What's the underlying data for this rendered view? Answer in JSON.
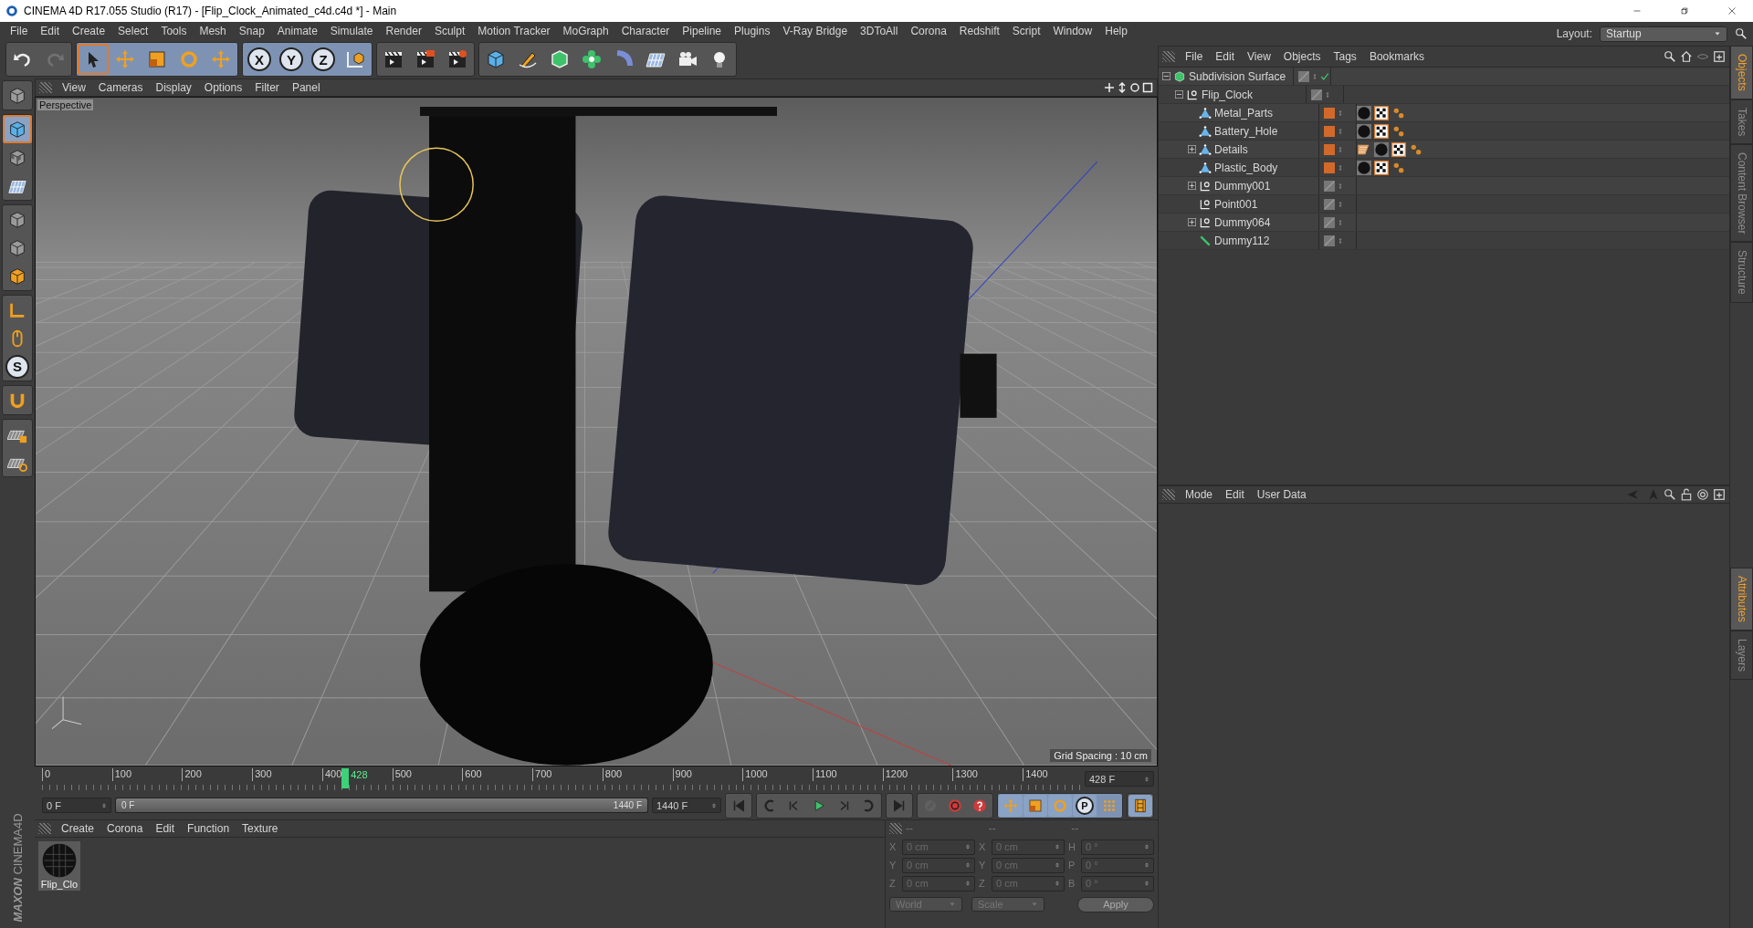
{
  "window": {
    "title": "CINEMA 4D R17.055 Studio (R17) - [Flip_Clock_Animated_c4d.c4d *] - Main"
  },
  "menu": [
    "File",
    "Edit",
    "Create",
    "Select",
    "Tools",
    "Mesh",
    "Snap",
    "Animate",
    "Simulate",
    "Render",
    "Sculpt",
    "Motion Tracker",
    "MoGraph",
    "Character",
    "Pipeline",
    "Plugins",
    "V-Ray Bridge",
    "3DToAll",
    "Corona",
    "Redshift",
    "Script",
    "Window",
    "Help"
  ],
  "layout": {
    "label": "Layout:",
    "value": "Startup"
  },
  "toolbar": [
    [
      {
        "kind": "undo-arrow",
        "selected": false,
        "disabled": false
      },
      {
        "kind": "redo-arrow",
        "selected": false,
        "disabled": true
      }
    ],
    [
      {
        "kind": "cursor",
        "selected": true,
        "disabled": false
      },
      {
        "kind": "move-arrows",
        "selected": false,
        "disabled": false
      },
      {
        "kind": "scale-square",
        "selected": false,
        "disabled": false
      },
      {
        "kind": "rotate-circle",
        "selected": false,
        "disabled": false
      },
      {
        "kind": "cross-arrows",
        "selected": false,
        "disabled": false
      }
    ],
    [
      {
        "kind": "letter",
        "label": "X",
        "selected": false,
        "disabled": false
      },
      {
        "kind": "letter",
        "label": "Y",
        "selected": false,
        "disabled": false
      },
      {
        "kind": "letter",
        "label": "Z",
        "selected": false,
        "disabled": false
      },
      {
        "kind": "coordinate-cube",
        "selected": false,
        "disabled": false
      }
    ],
    [
      {
        "kind": "clapper",
        "selected": false,
        "disabled": false
      },
      {
        "kind": "clapper-play",
        "selected": false,
        "disabled": false
      },
      {
        "kind": "clapper-gear",
        "selected": false,
        "disabled": false
      }
    ],
    [
      {
        "kind": "cube",
        "selected": false,
        "disabled": false
      },
      {
        "kind": "pen",
        "selected": false,
        "disabled": false
      },
      {
        "kind": "subdivision-cube",
        "selected": false,
        "disabled": false
      },
      {
        "kind": "flower",
        "selected": false,
        "disabled": false
      },
      {
        "kind": "bent-tube",
        "selected": false,
        "disabled": false
      },
      {
        "kind": "floor-grid",
        "selected": false,
        "disabled": false
      },
      {
        "kind": "camera",
        "selected": false,
        "disabled": false
      },
      {
        "kind": "light-bulb",
        "selected": false,
        "disabled": false
      }
    ]
  ],
  "side_tools": [
    [
      {
        "kind": "model-cube",
        "selected": false,
        "disabled": false
      }
    ],
    [
      {
        "kind": "cube",
        "selected": true,
        "disabled": false
      },
      {
        "kind": "checker-cube",
        "selected": false,
        "disabled": false
      },
      {
        "kind": "grid-plane",
        "selected": false,
        "disabled": false
      }
    ],
    [
      {
        "kind": "point-cube",
        "selected": false,
        "disabled": false
      },
      {
        "kind": "edge-cube",
        "selected": false,
        "disabled": false
      },
      {
        "kind": "polygon-cube",
        "selected": false,
        "disabled": false
      }
    ],
    [
      {
        "kind": "axis-corner",
        "selected": false,
        "disabled": false
      },
      {
        "kind": "mouse",
        "selected": false,
        "disabled": false
      },
      {
        "kind": "letter",
        "label": "S",
        "selected": false,
        "disabled": false
      }
    ],
    [
      {
        "kind": "magnet",
        "selected": false,
        "disabled": false
      }
    ],
    [
      {
        "kind": "grid-lock",
        "selected": false,
        "disabled": false
      },
      {
        "kind": "grid-snap",
        "selected": false,
        "disabled": false
      }
    ]
  ],
  "logo": {
    "brand": "MAXON",
    "product": "CINEMA4D"
  },
  "viewport": {
    "menu": [
      "View",
      "Cameras",
      "Display",
      "Options",
      "Filter",
      "Panel"
    ],
    "camera": "Perspective",
    "grid_spacing": "Grid Spacing : 10 cm"
  },
  "timeline": {
    "ticks": [
      "0",
      "100",
      "200",
      "300",
      "400",
      "500",
      "600",
      "700",
      "800",
      "900",
      "1000",
      "1100",
      "1200",
      "1300",
      "1400"
    ],
    "current": "428",
    "level": 0.297,
    "frame_field": "428 F"
  },
  "transport": {
    "start_field": "0 F",
    "range": {
      "start": "0 F",
      "end": "1440 F",
      "level": 1
    },
    "end_field": "1440 F",
    "buttons": [
      [
        {
          "kind": "go-start",
          "selected": false,
          "disabled": false
        }
      ],
      [
        {
          "kind": "loop-back",
          "selected": false,
          "disabled": false
        },
        {
          "kind": "step-back",
          "selected": false,
          "disabled": false
        },
        {
          "kind": "play",
          "selected": false,
          "disabled": false
        },
        {
          "kind": "step-forward",
          "selected": false,
          "disabled": false
        },
        {
          "kind": "loop-forward",
          "selected": false,
          "disabled": false
        }
      ],
      [
        {
          "kind": "go-end",
          "selected": false,
          "disabled": false
        }
      ],
      [
        {
          "kind": "key",
          "selected": false,
          "disabled": true
        },
        {
          "kind": "record",
          "selected": false,
          "disabled": false
        },
        {
          "kind": "question",
          "selected": false,
          "disabled": false
        }
      ],
      [
        {
          "kind": "move-arrows",
          "selected": true,
          "disabled": false
        },
        {
          "kind": "scale-square",
          "selected": true,
          "disabled": false
        },
        {
          "kind": "rotate-circle",
          "selected": true,
          "disabled": false
        },
        {
          "kind": "letter",
          "label": "P",
          "selected": true,
          "disabled": false
        },
        {
          "kind": "dots-grid",
          "selected": false,
          "disabled": false
        }
      ],
      [
        {
          "kind": "film-strip",
          "selected": true,
          "disabled": false
        }
      ]
    ]
  },
  "materials": {
    "menu": [
      "Create",
      "Corona",
      "Edit",
      "Function",
      "Texture"
    ],
    "items": [
      {
        "name": "Flip_Clo"
      }
    ]
  },
  "coordinates": {
    "disabled": true,
    "headers": [
      "--",
      "--",
      "--"
    ],
    "rows": [
      [
        {
          "axis": "X",
          "value": "0 cm"
        },
        {
          "axis": "X",
          "value": "0 cm"
        },
        {
          "axis": "H",
          "value": "0 °"
        }
      ],
      [
        {
          "axis": "Y",
          "value": "0 cm"
        },
        {
          "axis": "Y",
          "value": "0 cm"
        },
        {
          "axis": "P",
          "value": "0 °"
        }
      ],
      [
        {
          "axis": "Z",
          "value": "0 cm"
        },
        {
          "axis": "Z",
          "value": "0 cm"
        },
        {
          "axis": "B",
          "value": "0 °"
        }
      ]
    ],
    "space": "World",
    "mode": "Scale",
    "apply": "Apply"
  },
  "objects": {
    "menu": [
      "File",
      "Edit",
      "View",
      "Objects",
      "Tags",
      "Bookmarks"
    ],
    "tree": [
      {
        "name": "Subdivision Surface",
        "kind": "subdivision",
        "expanded": true,
        "enabled": true,
        "children": [
          {
            "name": "Flip_Clock",
            "kind": "null",
            "expanded": true,
            "children": [
              {
                "name": "Metal_Parts",
                "kind": "polygon",
                "color": "#d2692a",
                "tags": [
                  {
                    "kind": "sphere"
                  },
                  {
                    "kind": "checker"
                  },
                  {
                    "kind": "dots"
                  }
                ]
              },
              {
                "name": "Battery_Hole",
                "kind": "polygon",
                "color": "#d2692a",
                "tags": [
                  {
                    "kind": "sphere"
                  },
                  {
                    "kind": "checker"
                  },
                  {
                    "kind": "dots"
                  }
                ]
              },
              {
                "name": "Details",
                "kind": "polygon",
                "expanded": false,
                "color": "#d2692a",
                "tags": [
                  {
                    "kind": "uvw"
                  },
                  {
                    "kind": "sphere"
                  },
                  {
                    "kind": "checker"
                  },
                  {
                    "kind": "dots"
                  }
                ]
              },
              {
                "name": "Plastic_Body",
                "kind": "polygon",
                "color": "#d2692a",
                "tags": [
                  {
                    "kind": "sphere"
                  },
                  {
                    "kind": "checker"
                  },
                  {
                    "kind": "dots"
                  }
                ]
              },
              {
                "name": "Dummy001",
                "kind": "null",
                "expanded": false
              },
              {
                "name": "Point001",
                "kind": "null"
              },
              {
                "name": "Dummy064",
                "kind": "null",
                "expanded": false
              },
              {
                "name": "Dummy112",
                "kind": "spline"
              }
            ]
          }
        ]
      }
    ]
  },
  "attributes": {
    "menu": [
      "Mode",
      "Edit",
      "User Data"
    ]
  },
  "side_tabs_top": [
    {
      "label": "Objects",
      "selected": true
    },
    {
      "label": "Takes",
      "selected": false
    },
    {
      "label": "Content Browser",
      "selected": false
    },
    {
      "label": "Structure",
      "selected": false
    }
  ],
  "side_tabs_bottom": [
    {
      "label": "Attributes",
      "selected": true
    },
    {
      "label": "Layers",
      "selected": false
    }
  ]
}
